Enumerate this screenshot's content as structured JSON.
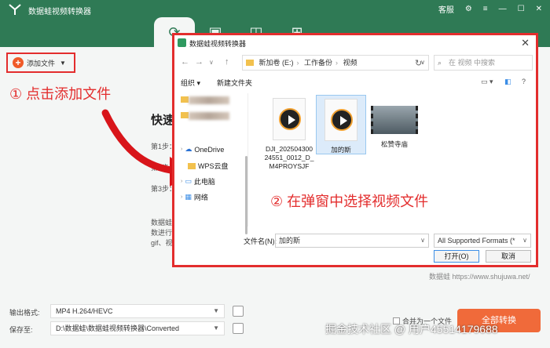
{
  "app": {
    "title": "数据蛙视频转换器",
    "header_links": [
      "客服"
    ],
    "colors": {
      "header": "#2f7a55",
      "accent": "#f06a3a",
      "highlight_red": "#e32d2d"
    }
  },
  "toolbar": {
    "add_file_label": "添加文件"
  },
  "annotations": {
    "step1": "① 点击添加文件",
    "step2": "② 在弹窗中选择视频文件"
  },
  "main": {
    "quick_title": "快速",
    "steps": [
      "第1步：",
      "第2步：",
      "第3步："
    ],
    "desc_lines": [
      "数据蛙",
      "数进行",
      "gif、视"
    ],
    "site": "数据蛙   https://www.shujuwa.net/"
  },
  "dialog": {
    "title": "数据蛙视频转换器",
    "path": [
      "新加卷 (E:)",
      "工作备份",
      "视频"
    ],
    "search_placeholder": "在 视频 中搜索",
    "organize_label": "组织",
    "new_folder_label": "新建文件夹",
    "sidebar": [
      {
        "label": "OneDrive",
        "icon": "cloud-icon"
      },
      {
        "label": "WPS云盘",
        "icon": "folder-icon"
      },
      {
        "label": "此电脑",
        "icon": "computer-icon"
      },
      {
        "label": "网络",
        "icon": "network-icon"
      }
    ],
    "files": [
      {
        "name": "DJI_20250430024551_0012_D_M4PROYSJF",
        "type": "video"
      },
      {
        "name": "加的斯",
        "type": "video",
        "selected": true
      },
      {
        "name": "松赞寺庙",
        "type": "video-thumb"
      }
    ],
    "filename_label": "文件名(N):",
    "filename_value": "加的斯",
    "filetype_value": "All Supported Formats (*",
    "open_label": "打开(O)",
    "cancel_label": "取消"
  },
  "bottom": {
    "output_format_label": "输出格式:",
    "output_format_value": "MP4 H.264/HEVC",
    "save_to_label": "保存至:",
    "save_to_value": "D:\\数据蛙\\数据蛙视频转换器\\Converted",
    "merge_label": "合并为一个文件",
    "convert_all_label": "全部转换",
    "watermark": "掘金技术社区 @ 用户45514179688"
  }
}
